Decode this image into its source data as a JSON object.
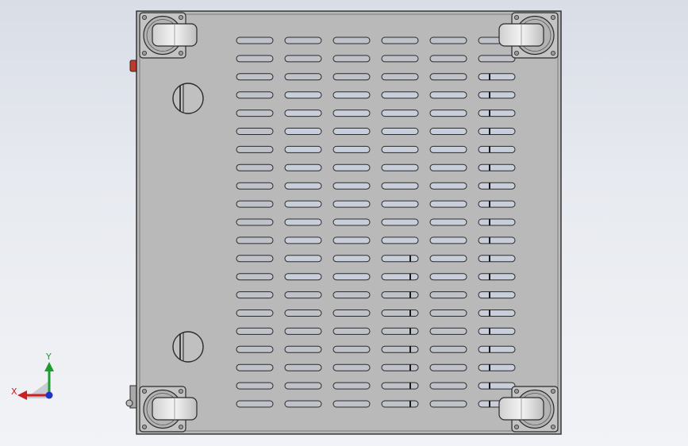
{
  "viewport": {
    "background_top": "#d9dde6",
    "background_bottom": "#f2f3f6"
  },
  "model": {
    "plate_color": "#b9b9b9",
    "edge_color": "#2b2b2b",
    "slot_fill": "#c9cfda",
    "slot_rows": 21,
    "slot_columns": 6,
    "caster_count": 4,
    "caster_icon": "caster-wheel-icon",
    "hole_icon": "round-hole-icon",
    "accent_red": "#c0392b"
  },
  "triad": {
    "x_label": "X",
    "y_label": "Y",
    "x_color": "#cc1f1f",
    "y_color": "#1e9b2e",
    "z_color": "#1f33c8"
  }
}
